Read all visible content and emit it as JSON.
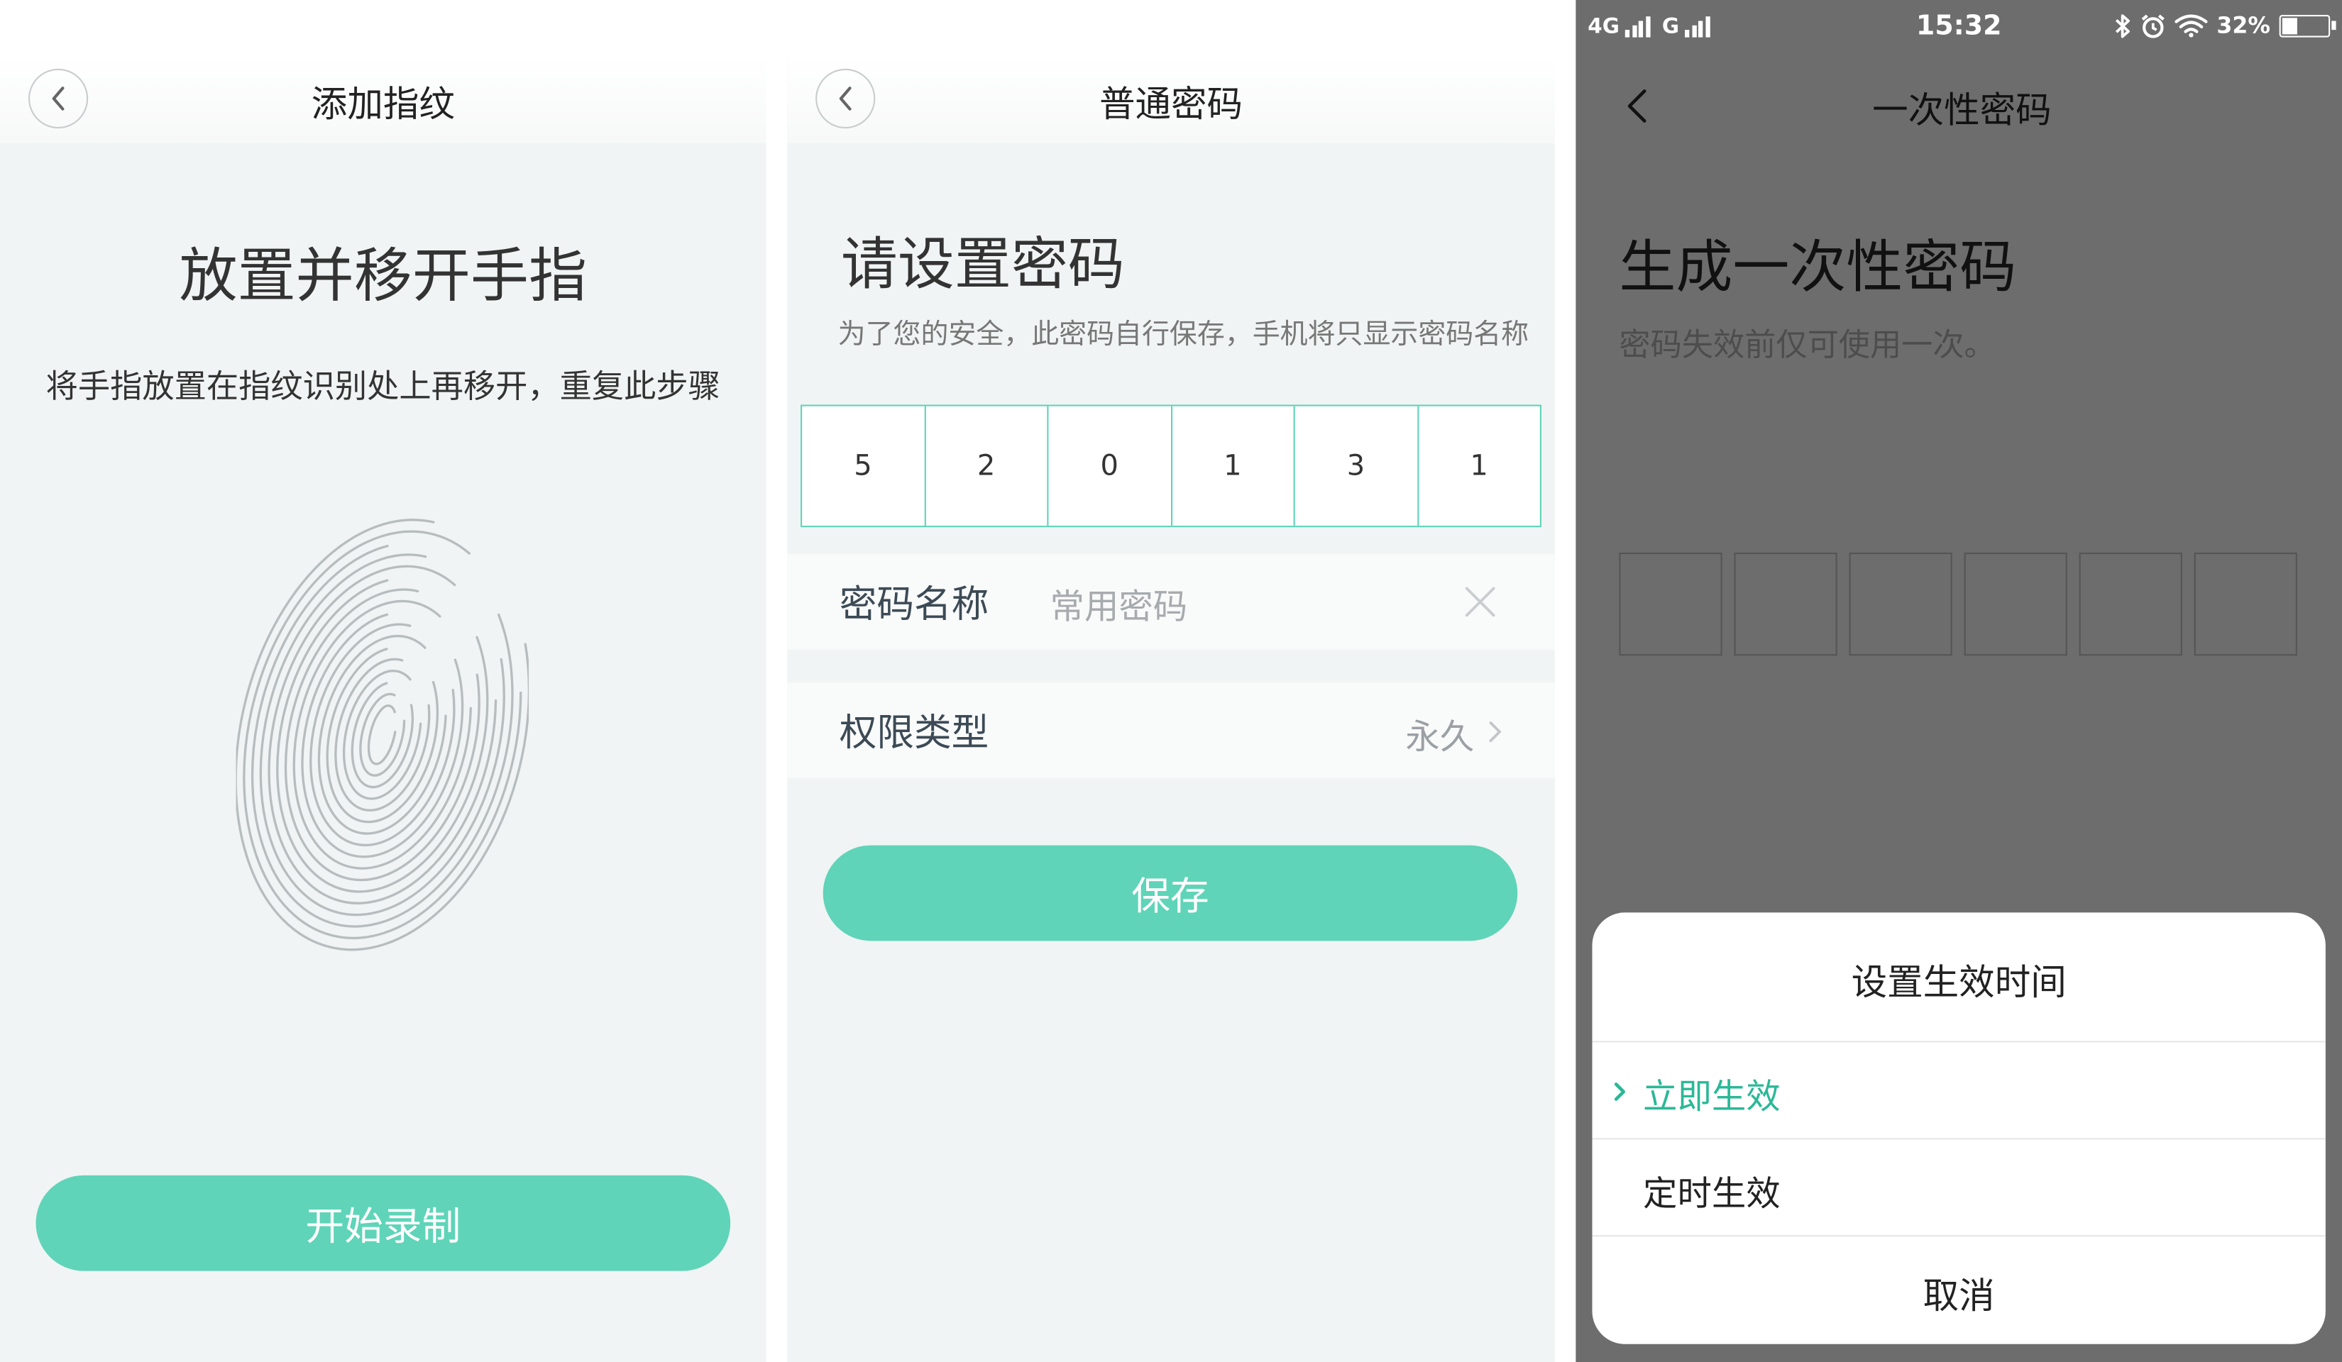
{
  "panel_fingerprint": {
    "header_title": "添加指纹",
    "title": "放置并移开手指",
    "subtitle": "将手指放置在指纹识别处上再移开，重复此步骤",
    "start_button": "开始录制"
  },
  "panel_password": {
    "header_title": "普通密码",
    "title": "请设置密码",
    "hint": "为了您的安全，此密码自行保存，手机将只显示密码名称",
    "digits": [
      "5",
      "2",
      "0",
      "1",
      "3",
      "1"
    ],
    "name_label": "密码名称",
    "name_placeholder": "常用密码",
    "permission_label": "权限类型",
    "permission_value": "永久",
    "save_button": "保存"
  },
  "panel_otp": {
    "status": {
      "network_1": "4G",
      "network_2": "G",
      "time": "15:32",
      "battery": "32%"
    },
    "header_title": "一次性密码",
    "title": "生成一次性密码",
    "subtitle": "密码失效前仅可使用一次。",
    "sheet": {
      "title": "设置生效时间",
      "options": [
        {
          "label": "立即生效",
          "selected": true
        },
        {
          "label": "定时生效",
          "selected": false
        }
      ],
      "cancel": "取消"
    }
  },
  "colors": {
    "accent": "#5fd4b8",
    "accent_text": "#2bb896",
    "overlay": "#6d6d6d"
  }
}
